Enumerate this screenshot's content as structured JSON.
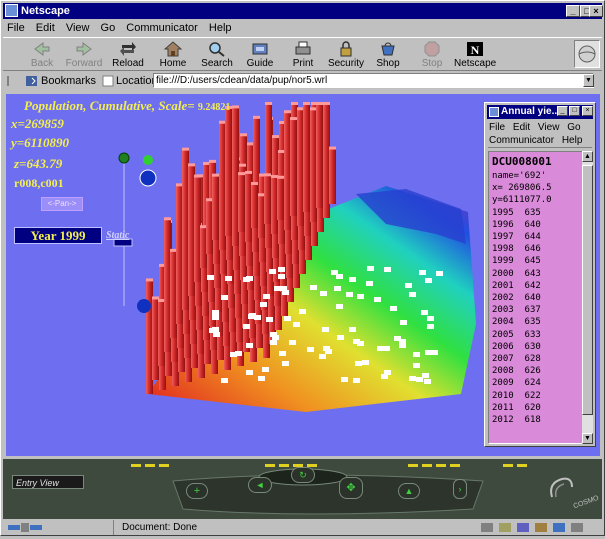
{
  "window": {
    "title": "Netscape"
  },
  "menu": [
    "File",
    "Edit",
    "View",
    "Go",
    "Communicator",
    "Help"
  ],
  "toolbar": [
    {
      "label": "Back",
      "icon": "back-arrow-icon",
      "enabled": false
    },
    {
      "label": "Forward",
      "icon": "forward-arrow-icon",
      "enabled": false
    },
    {
      "label": "Reload",
      "icon": "reload-icon",
      "enabled": true
    },
    {
      "label": "Home",
      "icon": "home-icon",
      "enabled": true
    },
    {
      "label": "Search",
      "icon": "search-icon",
      "enabled": true
    },
    {
      "label": "Guide",
      "icon": "guide-icon",
      "enabled": true
    },
    {
      "label": "Print",
      "icon": "print-icon",
      "enabled": true
    },
    {
      "label": "Security",
      "icon": "lock-icon",
      "enabled": true
    },
    {
      "label": "Shop",
      "icon": "shop-icon",
      "enabled": true
    },
    {
      "label": "Stop",
      "icon": "stop-icon",
      "enabled": false
    },
    {
      "label": "Netscape",
      "icon": "netscape-n-icon",
      "enabled": true
    }
  ],
  "location": {
    "bookmarks_label": "Bookmarks",
    "label": "Location:",
    "url": "file:///D:/users/cdean/data/pup/nor5.wrl"
  },
  "scene": {
    "title_line": "Population, Cumulative, Scale=",
    "scale_value": "9.24821",
    "x": "x=269859",
    "y": "y=6110890",
    "z": "z=643.79",
    "cell": "r008,c001",
    "pan_button": "<-Pan->",
    "year": "Year 1999",
    "static_label": "Static"
  },
  "subwindow": {
    "title": "Annual yie...",
    "menu1": [
      "File",
      "Edit",
      "View",
      "Go"
    ],
    "menu2": [
      "Communicator",
      "Help"
    ],
    "header": "DCU008001",
    "name": "name='692'",
    "x": "x= 269806.5",
    "y": "y=6111077.0",
    "rows": [
      [
        "1995",
        "635"
      ],
      [
        "1996",
        "640"
      ],
      [
        "1997",
        "644"
      ],
      [
        "1998",
        "646"
      ],
      [
        "1999",
        "645"
      ],
      [
        "2000",
        "643"
      ],
      [
        "2001",
        "642"
      ],
      [
        "2002",
        "640"
      ],
      [
        "2003",
        "637"
      ],
      [
        "2004",
        "635"
      ],
      [
        "2005",
        "633"
      ],
      [
        "2006",
        "630"
      ],
      [
        "2007",
        "628"
      ],
      [
        "2008",
        "626"
      ],
      [
        "2009",
        "624"
      ],
      [
        "2010",
        "622"
      ],
      [
        "2011",
        "620"
      ],
      [
        "2012",
        "618"
      ]
    ]
  },
  "navigator": {
    "viewpoint": "Entry View",
    "brand": "COSMO"
  },
  "status": {
    "text": "Document: Done"
  },
  "colors": {
    "title_bg": "#000080",
    "scene_bg": "#6e6ef0",
    "data_panel_bg": "#d98ad9",
    "overlay_text": "#f2ef50",
    "bars": "#d83030"
  }
}
